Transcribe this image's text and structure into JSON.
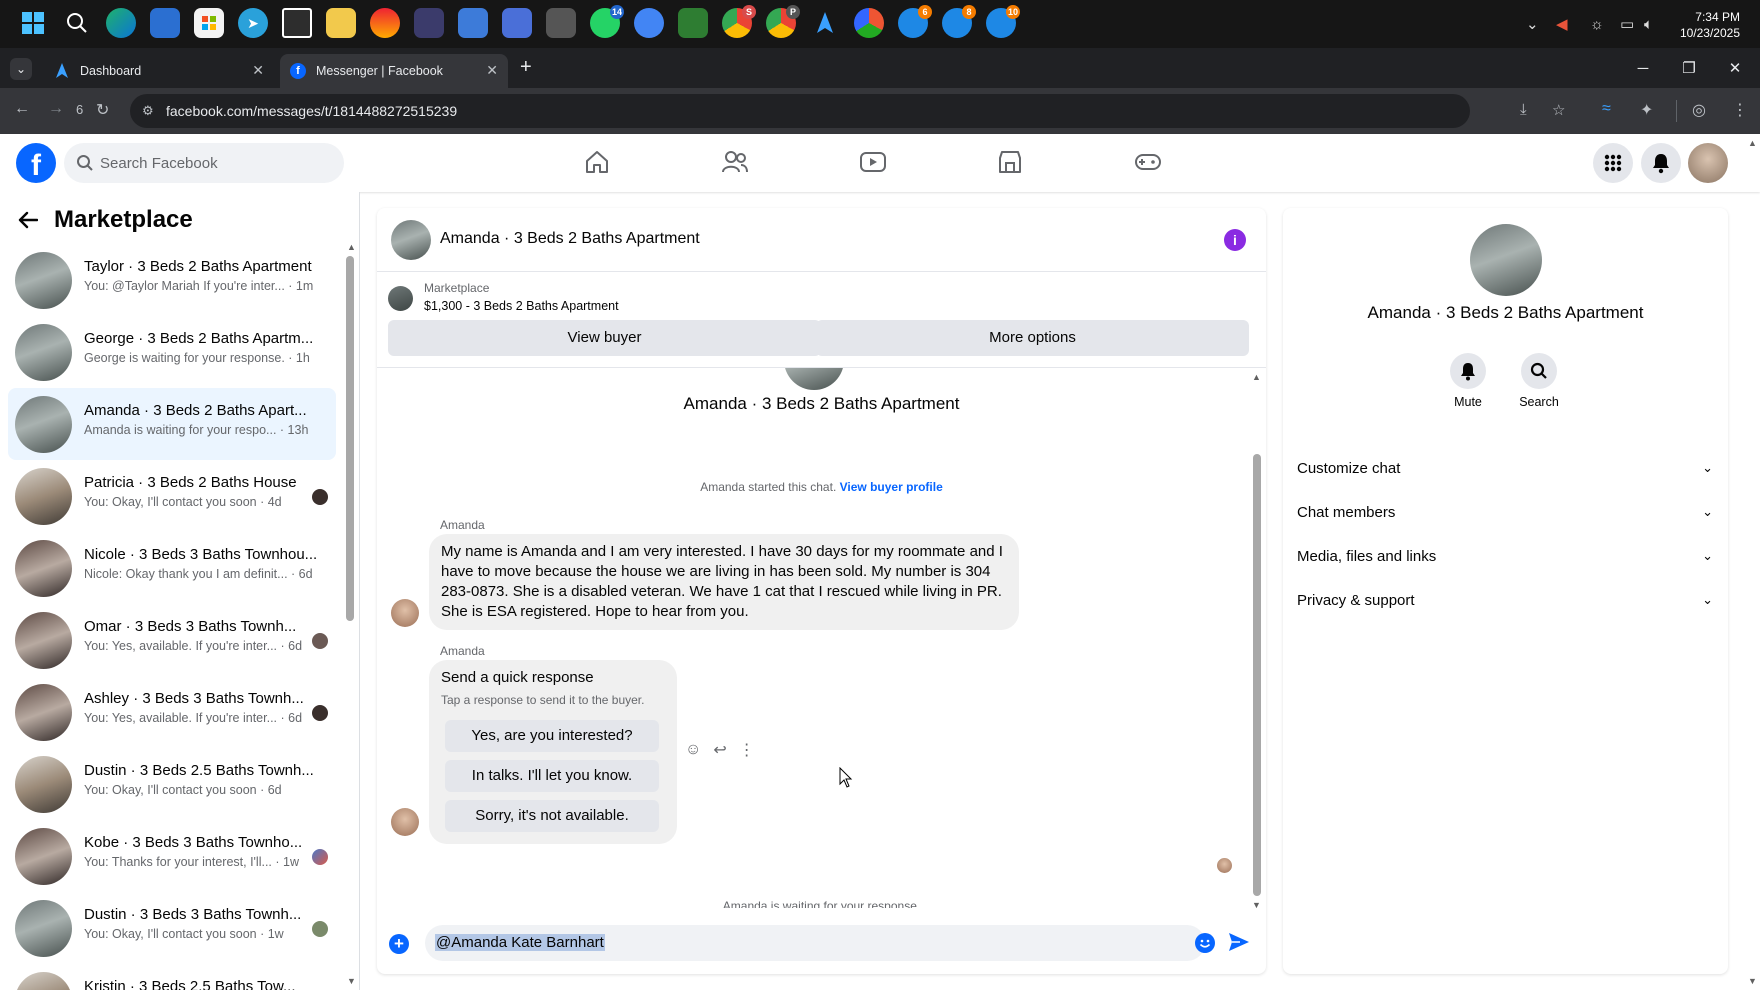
{
  "taskbar": {
    "clock_time": "7:34 PM",
    "clock_date": "10/23/2025",
    "badges": {
      "whatsapp": "14",
      "chrome_profile_a": "S",
      "chrome_profile_b": "P",
      "app_6": "6",
      "app_8": "8",
      "app_10": "10"
    }
  },
  "browser": {
    "tabs": [
      {
        "title": "Dashboard"
      },
      {
        "title": "Messenger | Facebook"
      }
    ],
    "new_tab_label": "+",
    "back_count": "6",
    "url": "facebook.com/messages/t/1814488272515239"
  },
  "facebook": {
    "search_placeholder": "Search Facebook"
  },
  "sidebar": {
    "title": "Marketplace",
    "conversations": [
      {
        "name": "Taylor · 3 Beds 2 Baths Apartment",
        "preview": "You: @Taylor Mariah If you're inter... · 1m"
      },
      {
        "name": "George · 3 Beds 2 Baths Apartm...",
        "preview": "George is waiting for your response. · 1h"
      },
      {
        "name": "Amanda · 3 Beds 2 Baths Apart...",
        "preview": "Amanda is waiting for your respo... · 13h"
      },
      {
        "name": "Patricia · 3 Beds 2 Baths House",
        "preview": "You: Okay, I'll contact you soon · 4d"
      },
      {
        "name": "Nicole · 3 Beds 3 Baths Townhou...",
        "preview": "Nicole: Okay thank you I am definit... · 6d"
      },
      {
        "name": "Omar · 3 Beds 3 Baths Townh...",
        "preview": "You: Yes, available. If you're inter... · 6d"
      },
      {
        "name": "Ashley · 3 Beds 3 Baths Townh...",
        "preview": "You: Yes, available. If you're inter... · 6d"
      },
      {
        "name": "Dustin · 3 Beds 2.5 Baths Townh...",
        "preview": "You: Okay, I'll contact you soon · 6d"
      },
      {
        "name": "Kobe · 3 Beds 3 Baths Townho...",
        "preview": "You: Thanks for your interest, I'll... · 1w"
      },
      {
        "name": "Dustin · 3 Beds 3 Baths Townh...",
        "preview": "You: Okay, I'll contact you soon · 1w"
      },
      {
        "name": "Kristin · 3 Beds 2.5 Baths Tow...",
        "preview": ""
      }
    ]
  },
  "chat": {
    "title": "Amanda · 3 Beds 2 Baths Apartment",
    "info_icon_label": "i",
    "listing": {
      "label": "Marketplace",
      "price_title": "$1,300 - 3 Beds 2 Baths Apartment",
      "view_buyer": "View buyer",
      "more_options": "More options"
    },
    "thread_name": "Amanda · 3 Beds 2 Baths Apartment",
    "started_text": "Amanda started this chat.",
    "view_profile_link": "View buyer profile",
    "messages": [
      {
        "sender": "Amanda",
        "text": "My name is Amanda and I am very interested. I have 30 days for my roommate and I have to move because the house we are living in has been sold. My number is 304 283-0873. She is a disabled veteran. We have 1 cat that I rescued while living in PR. She is ESA registered. Hope to hear from you."
      },
      {
        "sender": "Amanda"
      }
    ],
    "quick_response": {
      "title": "Send a quick response",
      "hint": "Tap a response to send it to the buyer.",
      "options": [
        "Yes, are you interested?",
        "In talks. I'll let you know.",
        "Sorry, it's not available."
      ]
    },
    "waiting_text": "Amanda is waiting for your response.",
    "composer_value": "@Amanda Kate Barnhart"
  },
  "info_panel": {
    "name": "Amanda · 3 Beds 2 Baths Apartment",
    "actions": [
      {
        "label": "Mute"
      },
      {
        "label": "Search"
      }
    ],
    "sections": [
      "Customize chat",
      "Chat members",
      "Media, files and links",
      "Privacy & support"
    ]
  },
  "colors": {
    "facebook_blue": "#0866ff",
    "active_row": "#ebf5ff",
    "info_purple": "#8a2be2"
  }
}
